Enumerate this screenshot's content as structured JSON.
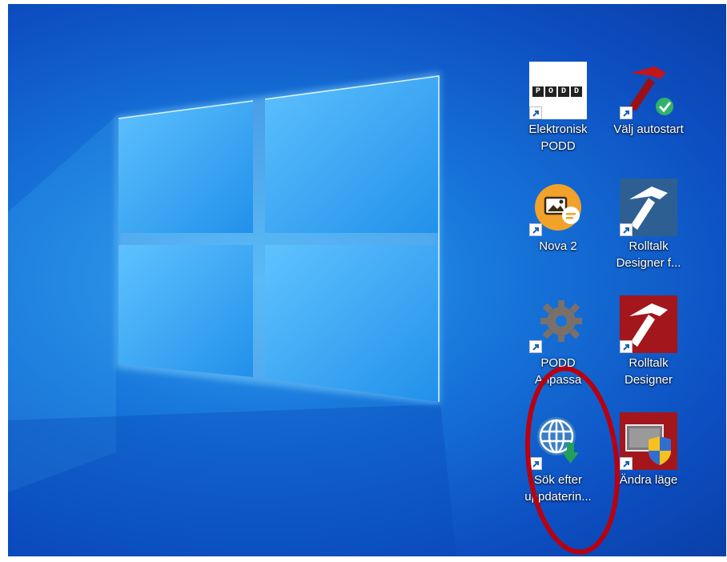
{
  "desktop": {
    "wallpaper": "windows-10-logo-wallpaper",
    "accent_color": "#1673d8",
    "annotation_color": "#b8000f",
    "icons": [
      {
        "label": "Elektronisk\nPODD",
        "icon": "podd-icon",
        "logo_text": [
          "P",
          "O",
          "D",
          "D"
        ]
      },
      {
        "label": "Välj autostart",
        "icon": "hammer-check-icon"
      },
      {
        "label": "Nova 2",
        "icon": "nova-icon"
      },
      {
        "label": "Rolltalk\nDesigner f...",
        "icon": "rolltalk-designer-blue-icon"
      },
      {
        "label": "PODD\nAnpassa",
        "icon": "gear-icon"
      },
      {
        "label": "Rolltalk\nDesigner",
        "icon": "rolltalk-designer-red-icon"
      },
      {
        "label": "Sök efter\nuppdaterin...",
        "icon": "globe-download-icon"
      },
      {
        "label": "Ändra läge",
        "icon": "change-mode-icon"
      }
    ]
  }
}
